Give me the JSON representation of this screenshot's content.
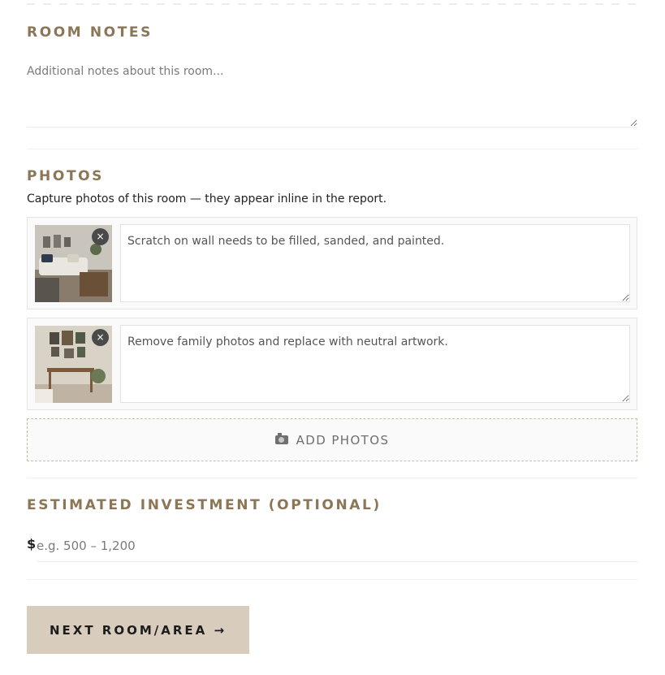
{
  "room_notes": {
    "title": "ROOM NOTES",
    "placeholder": "Additional notes about this room..."
  },
  "photos": {
    "title": "PHOTOS",
    "subtitle": "Capture photos of this room — they appear inline in the report.",
    "items": [
      {
        "caption": "Scratch on wall needs to be filled, sanded, and painted.",
        "remove_label": "×",
        "thumb_icon": "living-room-photo"
      },
      {
        "caption": "Remove family photos and replace with neutral artwork.",
        "remove_label": "×",
        "thumb_icon": "console-table-photo"
      }
    ],
    "add_label": "ADD PHOTOS",
    "add_icon": "camera-icon"
  },
  "investment": {
    "title": "ESTIMATED INVESTMENT (OPTIONAL)",
    "currency": "$",
    "placeholder": "e.g. 500 – 1,200"
  },
  "next_button": {
    "label": "NEXT ROOM/AREA →"
  },
  "colors": {
    "accent": "#8b7656",
    "button_bg": "#d8cdbd",
    "dashed_border": "#c9c0a4"
  }
}
